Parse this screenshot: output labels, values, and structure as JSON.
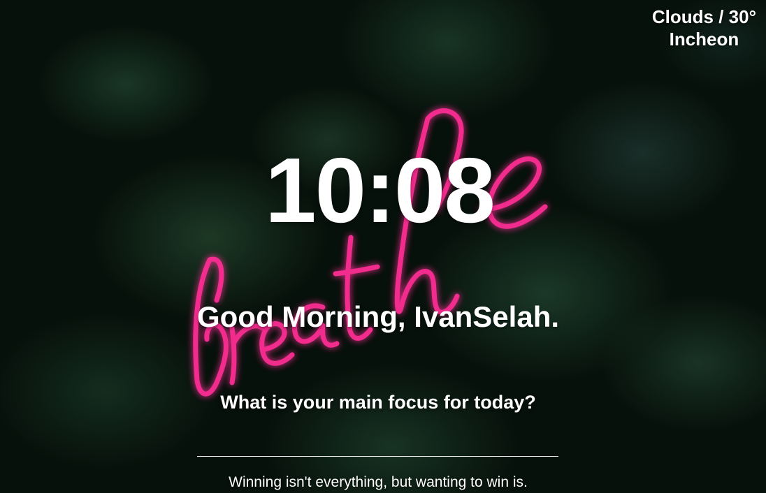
{
  "weather": {
    "condition_temp": "Clouds / 30°",
    "location": "Incheon"
  },
  "clock": {
    "time": "10:08"
  },
  "greeting": {
    "text": "Good Morning, IvanSelah."
  },
  "focus": {
    "prompt": "What is your main focus for today?",
    "value": "",
    "placeholder": ""
  },
  "quote": {
    "text": "Winning isn't everything, but wanting to win is."
  },
  "background": {
    "neon_sign_text": "breathe",
    "neon_color": "#ff2d95",
    "foliage_color": "#0f2a1a"
  }
}
